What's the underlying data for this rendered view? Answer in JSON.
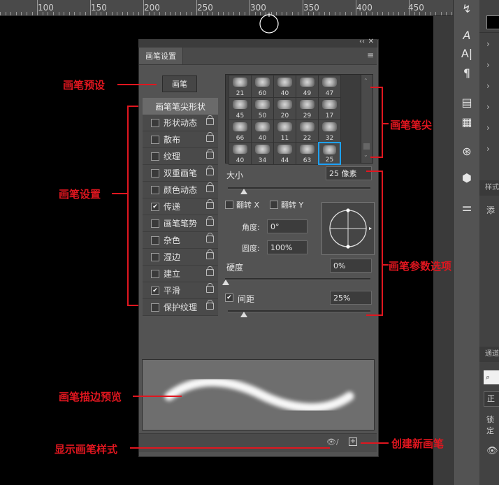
{
  "ruler": {
    "ticks": [
      "100",
      "150",
      "200",
      "250",
      "300",
      "350",
      "400",
      "450"
    ]
  },
  "right_strip": {
    "tools": [
      "type-icon",
      "character-panel-icon",
      "paragraph-panel-icon",
      "document-icon",
      "notes-icon",
      "adjust-icon",
      "3d-icon",
      "settings-icon"
    ],
    "glyphs": [
      "A",
      "A|",
      "¶"
    ]
  },
  "right_panels": {
    "frag1": "样式",
    "frag2": "添",
    "frag3": "通道",
    "frag4": "正",
    "frag5": "锁定"
  },
  "panel": {
    "tab": "画笔设置",
    "brush_button": "画笔",
    "tip_header": "画笔笔尖形状",
    "list": [
      {
        "label": "形状动态",
        "checked": false
      },
      {
        "label": "散布",
        "checked": false
      },
      {
        "label": "纹理",
        "checked": false
      },
      {
        "label": "双重画笔",
        "checked": false
      },
      {
        "label": "颜色动态",
        "checked": false
      },
      {
        "label": "传递",
        "checked": true
      },
      {
        "label": "画笔笔势",
        "checked": false
      },
      {
        "label": "杂色",
        "checked": false
      },
      {
        "label": "湿边",
        "checked": false
      },
      {
        "label": "建立",
        "checked": false
      },
      {
        "label": "平滑",
        "checked": true
      },
      {
        "label": "保护纹理",
        "checked": false
      }
    ],
    "tips": [
      "21",
      "60",
      "40",
      "49",
      "47",
      "45",
      "50",
      "20",
      "29",
      "17",
      "66",
      "40",
      "11",
      "22",
      "32",
      "40",
      "34",
      "44",
      "63",
      "25"
    ],
    "size_label": "大小",
    "size_value": "25 像素",
    "flip_x": "翻转 X",
    "flip_y": "翻转 Y",
    "angle_label": "角度:",
    "angle_value": "0°",
    "roundness_label": "圆度:",
    "roundness_value": "100%",
    "hardness_label": "硬度",
    "hardness_value": "0%",
    "spacing_label": "间距",
    "spacing_value": "25%",
    "spacing_checked": true
  },
  "annotations": {
    "brush_preset": "画笔预设",
    "brush_settings": "画笔设置",
    "brush_tip": "画笔笔尖",
    "brush_params": "画笔参数选项",
    "stroke_preview": "画笔描边预览",
    "show_style": "显示画笔样式",
    "new_brush": "创建新画笔"
  },
  "colors": {
    "annotation_red": "#e0161f",
    "selected_tip": "#1ea1ff"
  }
}
